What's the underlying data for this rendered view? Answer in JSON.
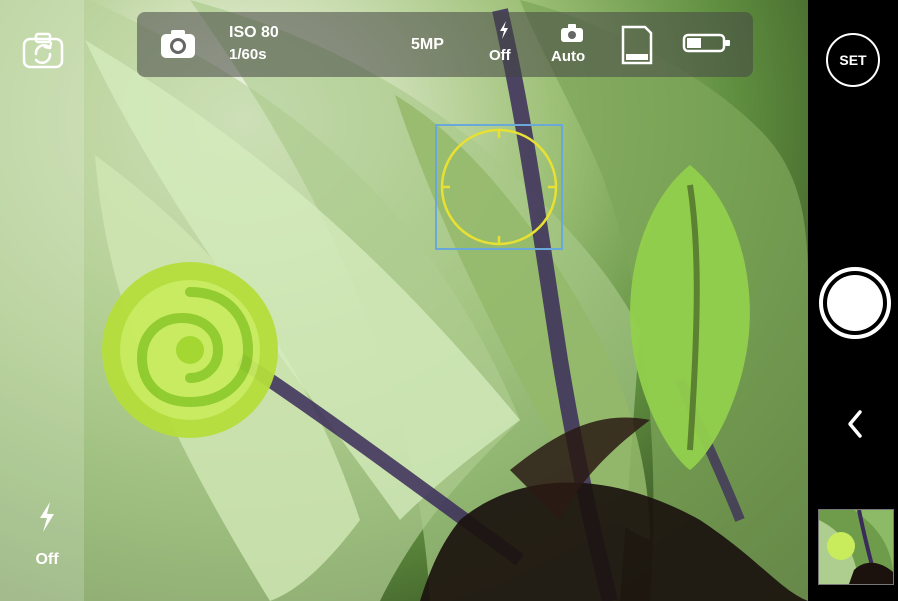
{
  "exposure": {
    "iso": "ISO 80",
    "shutter": "1/60s"
  },
  "resolution": "5MP",
  "flash_top": {
    "state": "Off"
  },
  "scene_mode": {
    "label": "Auto"
  },
  "left_flash": {
    "state": "Off"
  },
  "set_button": {
    "label": "SET"
  },
  "colors": {
    "focus_circle": "#e8e032",
    "focus_box": "#6aa8d9",
    "bar_bg": "#000000"
  },
  "icons": [
    "switch-camera-icon",
    "camera-icon",
    "flash-icon",
    "scene-camera-icon",
    "sd-card-icon",
    "battery-icon",
    "shutter-button-icon",
    "back-chevron-icon",
    "flash-icon"
  ]
}
